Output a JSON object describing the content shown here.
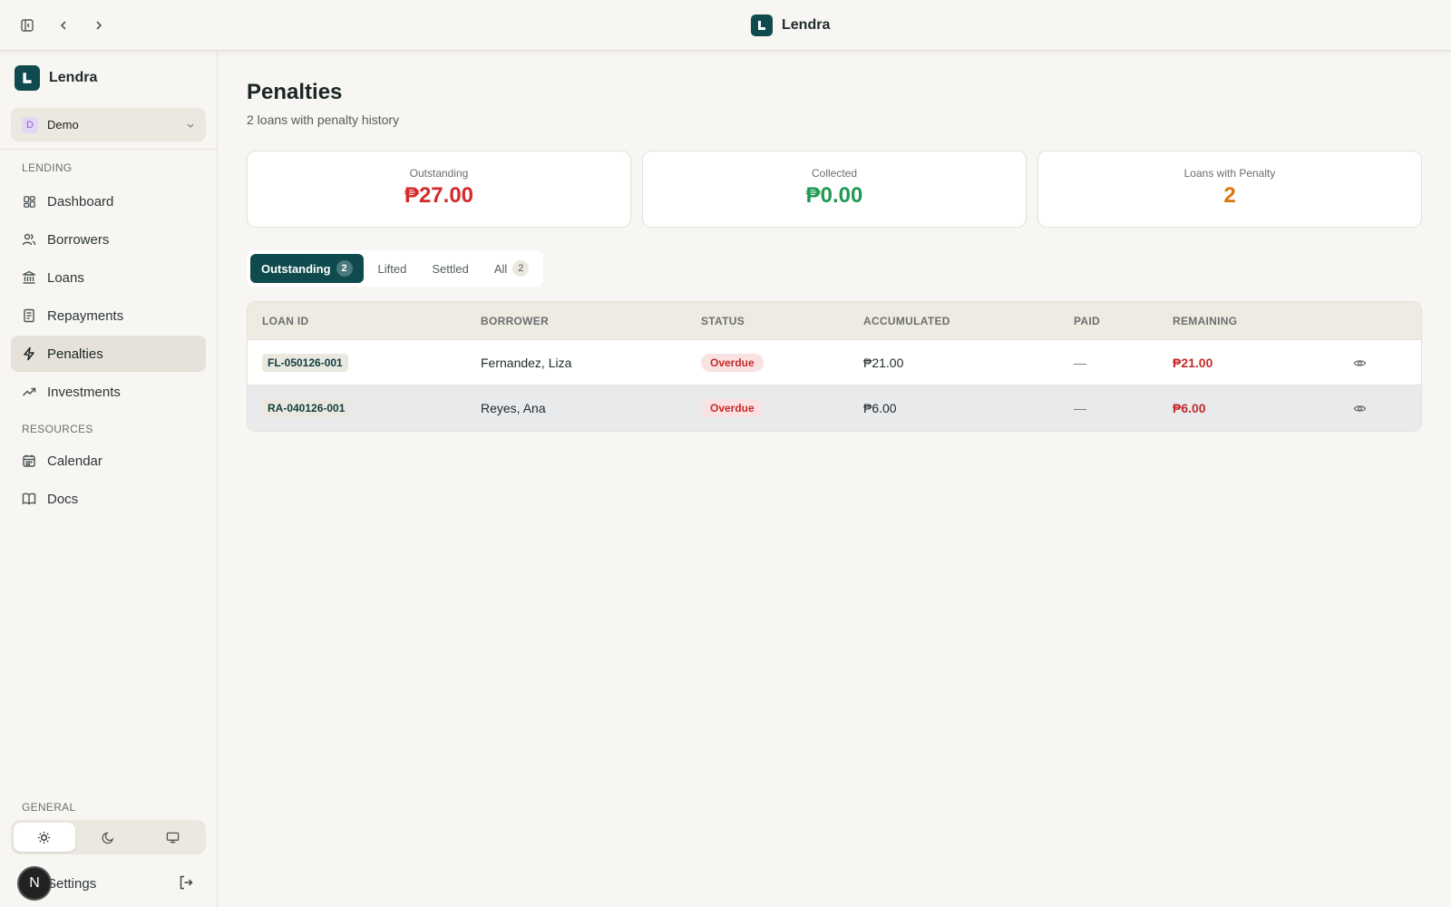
{
  "app": {
    "name": "Lendra"
  },
  "workspace": {
    "initial": "D",
    "name": "Demo"
  },
  "sidebar": {
    "section_lending": "LENDING",
    "section_resources": "RESOURCES",
    "section_general": "GENERAL",
    "lending_items": [
      {
        "label": "Dashboard",
        "icon": "dashboard-icon"
      },
      {
        "label": "Borrowers",
        "icon": "users-icon"
      },
      {
        "label": "Loans",
        "icon": "bank-icon"
      },
      {
        "label": "Repayments",
        "icon": "receipt-icon"
      },
      {
        "label": "Penalties",
        "icon": "lightning-icon",
        "active": true
      },
      {
        "label": "Investments",
        "icon": "trend-up-icon"
      }
    ],
    "resource_items": [
      {
        "label": "Calendar",
        "icon": "calendar-icon"
      },
      {
        "label": "Docs",
        "icon": "book-icon"
      }
    ],
    "settings_label": "Settings",
    "user_initial": "N"
  },
  "page": {
    "title": "Penalties",
    "subtitle": "2 loans with penalty history"
  },
  "stats": [
    {
      "label": "Outstanding",
      "value": "₱27.00",
      "color": "#d42a2a"
    },
    {
      "label": "Collected",
      "value": "₱0.00",
      "color": "#1f9a52"
    },
    {
      "label": "Loans with Penalty",
      "value": "2",
      "color": "#d9770f"
    }
  ],
  "tabs": [
    {
      "label": "Outstanding",
      "count": "2",
      "active": true
    },
    {
      "label": "Lifted"
    },
    {
      "label": "Settled"
    },
    {
      "label": "All",
      "count": "2"
    }
  ],
  "table": {
    "columns": [
      "LOAN ID",
      "BORROWER",
      "STATUS",
      "ACCUMULATED",
      "PAID",
      "REMAINING"
    ],
    "rows": [
      {
        "loan_id": "FL-050126-001",
        "borrower": "Fernandez, Liza",
        "status": "Overdue",
        "accumulated": "₱21.00",
        "paid": "—",
        "remaining": "₱21.00"
      },
      {
        "loan_id": "RA-040126-001",
        "borrower": "Reyes, Ana",
        "status": "Overdue",
        "accumulated": "₱6.00",
        "paid": "—",
        "remaining": "₱6.00"
      }
    ]
  }
}
